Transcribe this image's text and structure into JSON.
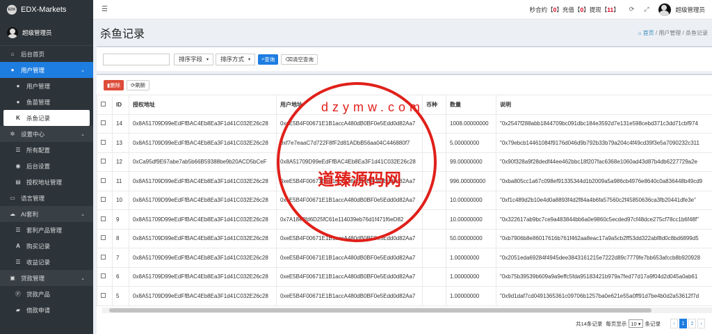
{
  "brand": {
    "logo": "EDX",
    "name": "EDX-Markets"
  },
  "sidebar": {
    "user": "超级管理员",
    "items": [
      {
        "label": "后台首页",
        "icon": "home-icon"
      },
      {
        "label": "用户管理",
        "icon": "users-icon"
      },
      {
        "label": "用户管理",
        "icon": "user-icon"
      },
      {
        "label": "鱼苗管理",
        "icon": "users-icon"
      },
      {
        "label": "杀鱼记录",
        "icon": "k-icon"
      },
      {
        "label": "设置中心",
        "icon": "gears-icon"
      },
      {
        "label": "所有配置",
        "icon": "list-icon"
      },
      {
        "label": "后台设置",
        "icon": "circle-icon"
      },
      {
        "label": "授权地址管理",
        "icon": "doc-icon"
      },
      {
        "label": "语言管理",
        "icon": "lang-icon"
      },
      {
        "label": "AI套利",
        "icon": "cloud-icon"
      },
      {
        "label": "套利产品管理",
        "icon": "list-icon"
      },
      {
        "label": "购买记录",
        "icon": "a-icon"
      },
      {
        "label": "收益记录",
        "icon": "list-icon"
      },
      {
        "label": "贷款管理",
        "icon": "money-icon"
      },
      {
        "label": "贷款产品",
        "icon": "p-icon"
      },
      {
        "label": "借款申请",
        "icon": "truck-icon"
      }
    ]
  },
  "topbar": {
    "stat1_label": "秒合约",
    "stat1_val": "0",
    "stat2_label": "充值",
    "stat2_val": "0",
    "stat3_label": "提现",
    "stat3_val": "11",
    "admin": "超级管理员"
  },
  "page": {
    "title": "杀鱼记录",
    "crumb_home": "首页",
    "crumb_mid": "用户管理",
    "crumb_cur": "杀鱼记录"
  },
  "filter": {
    "sort_field": "排序字段",
    "sort_order": "排序方式",
    "search": "查询",
    "clear": "清空查询"
  },
  "tools": {
    "delete": "删除",
    "refresh": "刷新"
  },
  "table": {
    "headers": [
      "ID",
      "授权地址",
      "用户地址",
      "币种",
      "数量",
      "说明"
    ],
    "rows": [
      {
        "id": "14",
        "auth": "0x8A51709D99eEdFfBAC4Eb8Ea3F1d41C032E26c28",
        "user": "0xeE5B4F00671E1B1accA480dB0BF0e5Edd0d82Aa7",
        "coin": "",
        "amount": "1008.00000000",
        "note": "\"0x2547f288abb1844709bc091dbc184e3592d7e131e598cebd371c3dd71cbf974"
      },
      {
        "id": "13",
        "auth": "0x8A51709D99eEdFfBAC4Eb8Ea3F1d41C032E26c28",
        "user": "0xf7e7eaaC7d722F8fF2d81ADbB56aa04C446880f7",
        "coin": "",
        "amount": "5.00000000",
        "note": "\"0x79ebcb14461084f9176d046d9b792b33b79a204c4f49cd39f3e5a7090232c311"
      },
      {
        "id": "12",
        "auth": "0xCa95df9E67abe7ab5b66B59388be9b20ACD5bCeF",
        "user": "0x8A51709D99eEdFfBAC4Eb8Ea3F1d41C032E26c28",
        "coin": "",
        "amount": "99.00000000",
        "note": "\"0x90f328a9f28dedf44ee462bbc18f207fac6368e1060ad43d87b4db6227729a2e"
      },
      {
        "id": "11",
        "auth": "0x8A51709D99eEdFfBAC4Eb8Ea3F1d41C032E26c28",
        "user": "0xeE5B4F00671E1B1accA480dB0BF0e5Edd0d82Aa7",
        "coin": "",
        "amount": "996.00000000",
        "note": "\"0xba805cc1a67c098ef91335344d1b2009a5a986cb4976e8640c0a836448b49cd9"
      },
      {
        "id": "10",
        "auth": "0x8A51709D99eEdFfBAC4Eb8Ea3F1d41C032E26c28",
        "user": "0xeE5B4F00671E1B1accA480dB0BF0e5Edd0d82Aa7",
        "coin": "",
        "amount": "10.00000000",
        "note": "\"0xf1c489d2b10e4d0a8893f4d2f84a4b6fa57560c2f45850636ca3fb20441dfe3e\""
      },
      {
        "id": "9",
        "auth": "0x8A51709D99eEdFfBAC4Eb8Ea3F1d41C032E26c28",
        "user": "0x7A18e8fd6D25fC61e114039eb76d1f471f6eD82",
        "coin": "",
        "amount": "10.00000000",
        "note": "\"0x322617ab9bc7ce9a483844bb6a0e9860c5ecded97cf48dce275cf78cc1b6f48f\""
      },
      {
        "id": "8",
        "auth": "0x8A51709D99eEdFfBAC4Eb8Ea3F1d41C032E26c28",
        "user": "0xeE5B4F00671E1B1accA480dB0BF0e5Edd0d82Aa7",
        "coin": "",
        "amount": "50.00000000",
        "note": "\"0xb7906b8e86017616b761f462aa8eac17a9a5cb2ff53dd322abf8d0c8bd6899d5"
      },
      {
        "id": "7",
        "auth": "0x8A51709D99eEdFfBAC4Eb8Ea3F1d41C032E26c28",
        "user": "0xeE5B4F00671E1B1accA480dB0BF0e5Edd0d82Aa7",
        "coin": "",
        "amount": "1.00000000",
        "note": "\"0x2051eda69284f4945dee3843161215e7222d89c7779fe7bb653afccb8b920928"
      },
      {
        "id": "6",
        "auth": "0x8A51709D99eEdFfBAC4Eb8Ea3F1d41C032E26c28",
        "user": "0xeE5B4F00671E1B1accA480dB0BF0e5Edd0d82Aa7",
        "coin": "",
        "amount": "1.00000000",
        "note": "\"0xb75b39539b609a9a9effc5fda95183421b979a7fed77d17a9f04d2d045a0ab61"
      },
      {
        "id": "5",
        "auth": "0x8A51709D99eEdFfBAC4Eb8Ea3F1d41C032E26c28",
        "user": "0xeE5B4F00671E1B1accA480dB0BF0e5Edd0d82Aa7",
        "coin": "",
        "amount": "1.00000000",
        "note": "\"0x9d1daf7cd0491365361c09706b1257ba0e621e55a0ff91d7be4b0d2a53612f7d"
      }
    ]
  },
  "pager": {
    "total": "共14条记录",
    "per_page_label": "每页显示",
    "per_page": "10",
    "unit": "条记录",
    "prev": "‹",
    "p1": "1",
    "p2": "2",
    "next": "›"
  },
  "watermark": {
    "text": "道臻源码网",
    "url": "dzymw.com"
  }
}
